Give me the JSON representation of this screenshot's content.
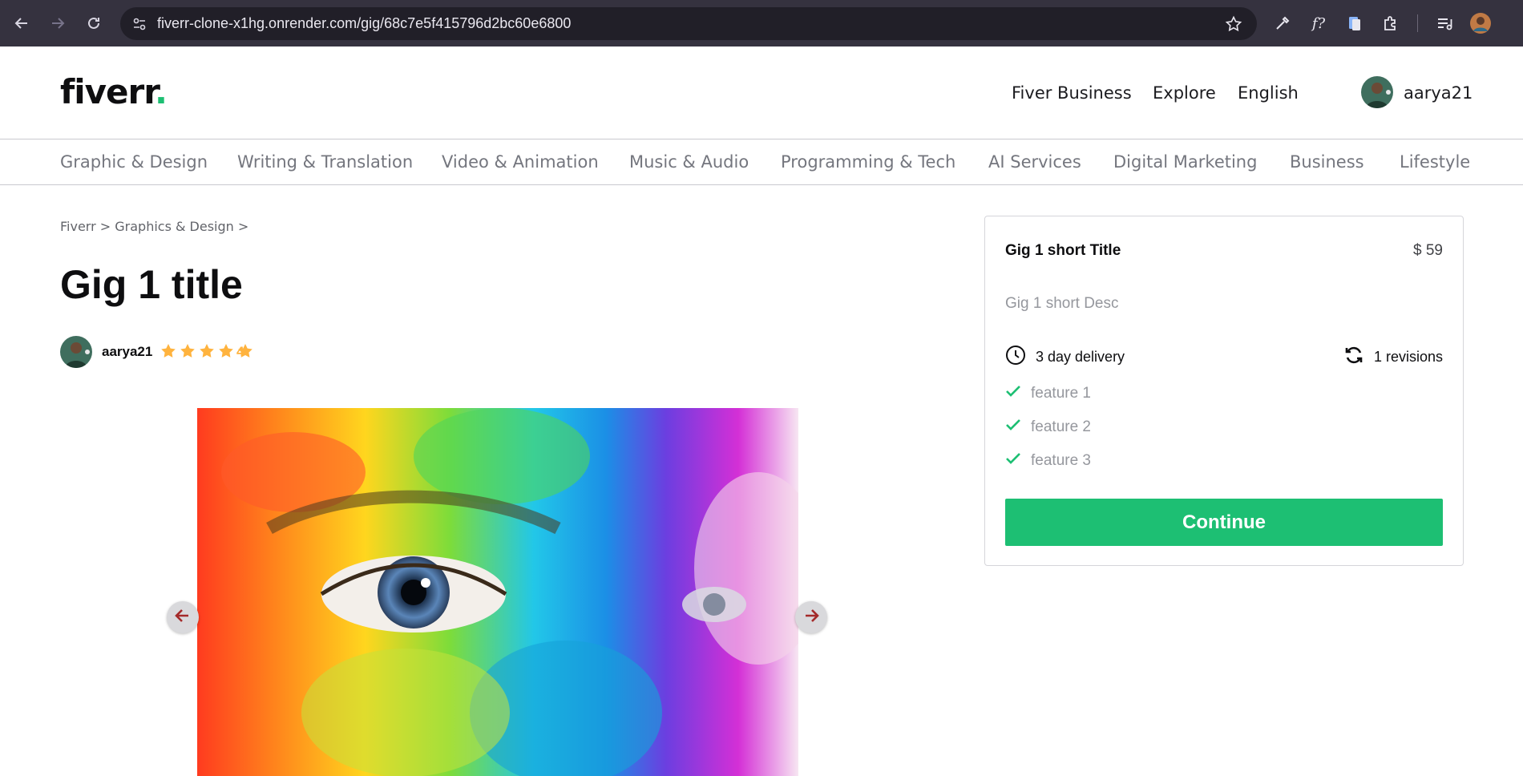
{
  "browser": {
    "url": "fiverr-clone-x1hg.onrender.com/gig/68c7e5f415796d2bc60e6800",
    "icons": [
      "back-icon",
      "forward-icon",
      "reload-icon",
      "site-info-icon",
      "bookmark-star-icon",
      "eyedropper-icon",
      "font-extension-icon",
      "clipboard-extension-icon",
      "extensions-puzzle-icon",
      "reading-list-icon",
      "profile-avatar-icon"
    ]
  },
  "header": {
    "logo_text": "fiverr",
    "logo_dot": ".",
    "links": [
      "Fiver Business",
      "Explore",
      "English"
    ],
    "username": "aarya21"
  },
  "categories": [
    "Graphic & Design",
    "Writing & Translation",
    "Video & Animation",
    "Music & Audio",
    "Programming & Tech",
    "AI Services",
    "Digital Marketing",
    "Business",
    "Lifestyle"
  ],
  "gig": {
    "breadcrumb": "Fiverr > Graphics & Design >",
    "title": "Gig 1 title",
    "seller": "aarya21",
    "rating_stars": 5,
    "rating": "4"
  },
  "package": {
    "short_title": "Gig 1 short Title",
    "price": "$ 59",
    "short_desc": "Gig 1 short Desc",
    "delivery": "3 day delivery",
    "revisions": "1 revisions",
    "features": [
      "feature 1",
      "feature 2",
      "feature 3"
    ],
    "continue_label": "Continue"
  },
  "colors": {
    "brand_green": "#1dbf73",
    "star_gold": "#ffb33e",
    "browser_bar": "#35323f",
    "arrow_red": "#a42a2a"
  }
}
